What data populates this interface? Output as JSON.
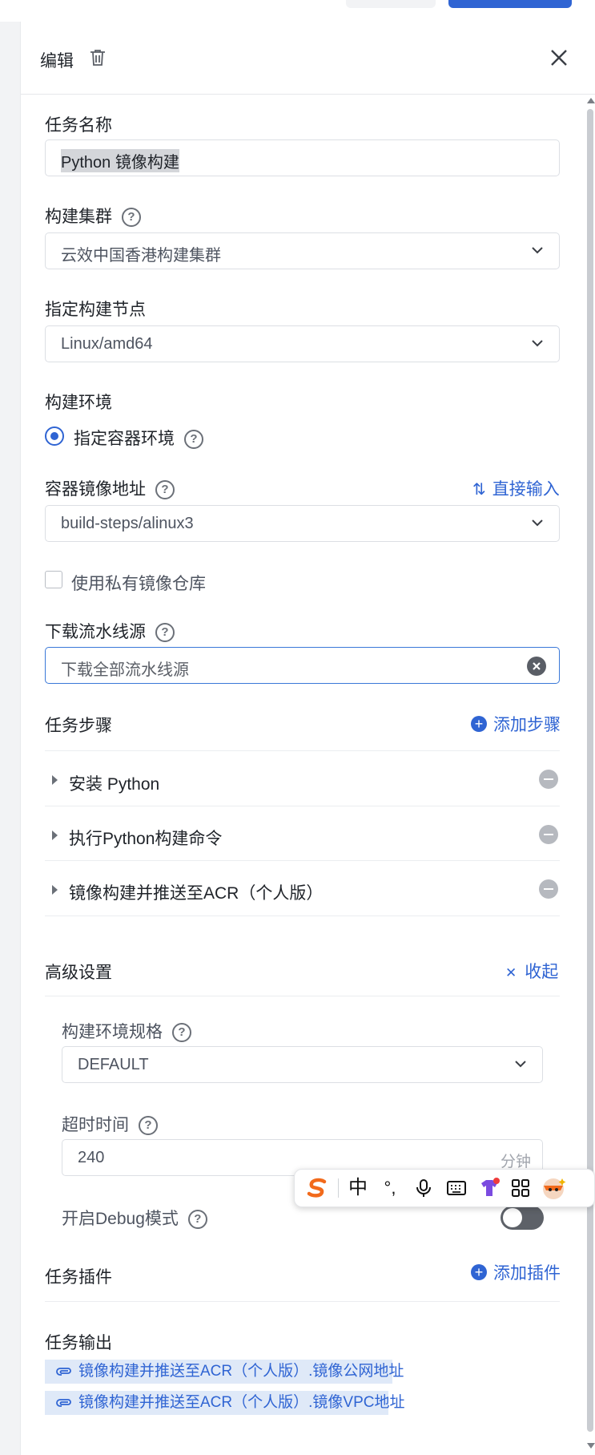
{
  "drawer": {
    "title": "编辑",
    "task_name": {
      "label": "任务名称",
      "value": "Python 镜像构建"
    },
    "cluster": {
      "label": "构建集群",
      "value": "云效中国香港构建集群"
    },
    "node": {
      "label": "指定构建节点",
      "value": "Linux/amd64"
    },
    "env": {
      "label": "构建环境",
      "option": "指定容器环境"
    },
    "image": {
      "label": "容器镜像地址",
      "switch_label": "直接输入",
      "value": "build-steps/alinux3"
    },
    "private_repo": {
      "label": "使用私有镜像仓库",
      "checked": false
    },
    "download": {
      "label": "下载流水线源",
      "placeholder": "下载全部流水线源"
    },
    "steps": {
      "label": "任务步骤",
      "add_label": "添加步骤",
      "items": [
        {
          "label": "安装 Python"
        },
        {
          "label": "执行Python构建命令"
        },
        {
          "label": "镜像构建并推送至ACR（个人版）"
        }
      ]
    },
    "advanced": {
      "label": "高级设置",
      "collapse_label": "收起",
      "spec": {
        "label": "构建环境规格",
        "value": "DEFAULT"
      },
      "timeout": {
        "label": "超时时间",
        "value": "240",
        "unit": "分钟"
      },
      "debug": {
        "label": "开启Debug模式",
        "enabled": false
      }
    },
    "plugins": {
      "label": "任务插件",
      "add_label": "添加插件"
    },
    "outputs": {
      "label": "任务输出",
      "items": [
        {
          "label": "镜像构建并推送至ACR（个人版）.镜像公网地址"
        },
        {
          "label": "镜像构建并推送至ACR（个人版）.镜像VPC地址"
        }
      ]
    }
  },
  "ime": {
    "chinese_label": "中",
    "punct_label": "°,"
  },
  "colors": {
    "accent": "#2f64d3",
    "text": "#1f2329",
    "muted": "#4e5460"
  }
}
